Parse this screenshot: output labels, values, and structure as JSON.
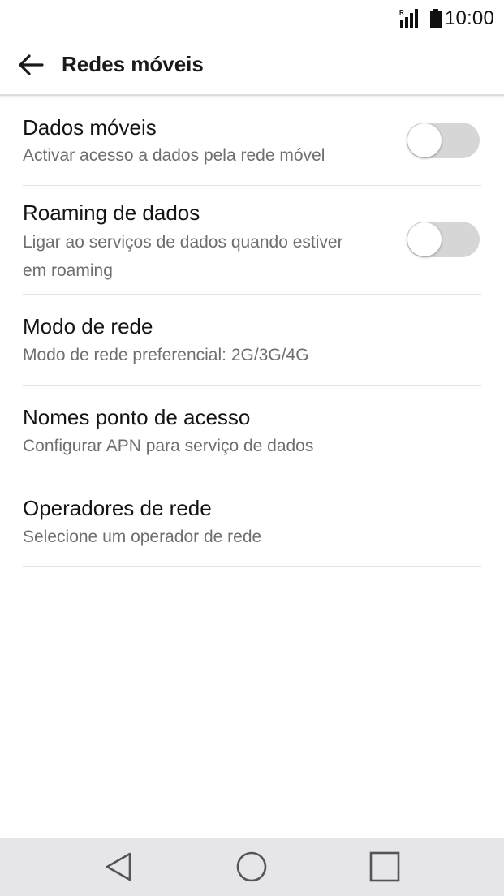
{
  "status_bar": {
    "time": "10:00",
    "signal_icon": "signal-roaming-icon",
    "roaming_indicator": "R",
    "battery_icon": "battery-icon"
  },
  "app_bar": {
    "title": "Redes móveis",
    "back_icon": "arrow-back-icon"
  },
  "settings": [
    {
      "title": "Dados móveis",
      "subtitle": "Activar acesso a dados pela rede móvel",
      "has_toggle": true,
      "toggle_on": false
    },
    {
      "title": "Roaming de dados",
      "subtitle": "Ligar ao serviços de dados quando estiver em roaming",
      "has_toggle": true,
      "toggle_on": false
    },
    {
      "title": "Modo de rede",
      "subtitle": "Modo de rede preferencial: 2G/3G/4G",
      "has_toggle": false
    },
    {
      "title": "Nomes ponto de acesso",
      "subtitle": "Configurar APN para serviço de dados",
      "has_toggle": false
    },
    {
      "title": "Operadores de rede",
      "subtitle": "Selecione um operador de rede",
      "has_toggle": false
    }
  ],
  "nav_bar": {
    "back_icon": "triangle-back-icon",
    "home_icon": "circle-home-icon",
    "recents_icon": "square-recents-icon"
  },
  "colors": {
    "background": "#ffffff",
    "title_text": "#141414",
    "subtitle_text": "#6e6e6e",
    "toggle_off_track": "#d6d6d6",
    "divider": "#e2e2e2",
    "nav_bar_bg": "#e6e6ea"
  }
}
